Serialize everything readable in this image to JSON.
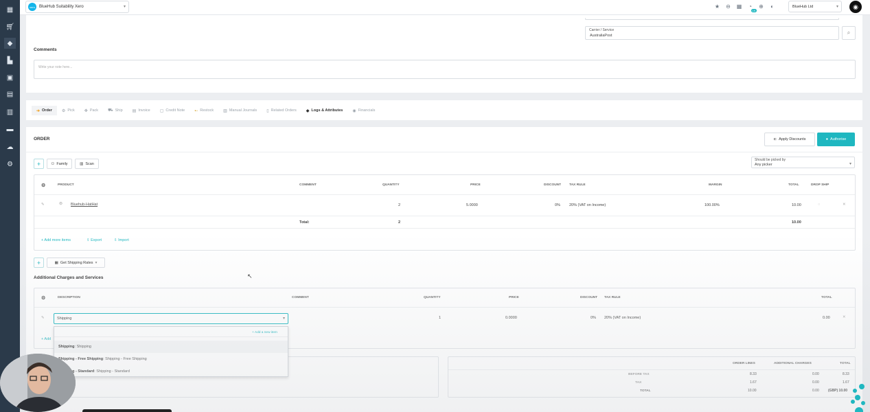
{
  "app": {
    "name": "BlueHub Suitability Xero",
    "logo_text": "xero",
    "company": "BlueHub Ltd"
  },
  "topbar": {
    "notif_badge": "19"
  },
  "carrier": {
    "label": "Carrier / Service",
    "value": "AustraliaPost"
  },
  "comments": {
    "title": "Comments",
    "placeholder": "Write your note here..."
  },
  "tabs": [
    "Order",
    "Pick",
    "Pack",
    "Ship",
    "Invoice",
    "Credit Note",
    "Restock",
    "Manual Journals",
    "Related Orders",
    "Logs & Attributes",
    "Financials"
  ],
  "order": {
    "title": "ORDER",
    "apply_discounts": "Apply Discounts",
    "authorise": "Authorise",
    "family": "Family",
    "scan": "Scan",
    "picker_label": "Should be picked by",
    "picker_value": "Any picker",
    "headers": [
      "PRODUCT",
      "COMMENT",
      "QUANTITY",
      "PRICE",
      "DISCOUNT",
      "TAX RULE",
      "MARGIN",
      "TOTAL",
      "DROP SHIP"
    ],
    "row": {
      "product": "Bluehub-HatHat",
      "quantity": "2",
      "price": "5.0000",
      "discount": "0%",
      "tax_rule": "20% (VAT on Income)",
      "margin": "100.00%",
      "total": "10.00"
    },
    "total_label": "Total:",
    "total_qty": "2",
    "total_amount": "10.00",
    "add_more": "+ Add more items",
    "export": "Export",
    "import": "Import"
  },
  "charges": {
    "get_rates": "Get Shipping Rates",
    "title": "Additional Charges and Services",
    "headers": [
      "DESCRIPTION",
      "COMMENT",
      "QUANTITY",
      "PRICE",
      "DISCOUNT",
      "TAX RULE",
      "TOTAL"
    ],
    "row": {
      "description": "Shipping",
      "quantity": "1",
      "price": "0.0000",
      "discount": "0%",
      "tax_rule": "20% (VAT on Income)",
      "total": "0.00"
    },
    "add_new_item": "+ Add a new item",
    "options": [
      {
        "bold": "Shipping",
        "rest": ": Shipping"
      },
      {
        "bold": "Shipping - Free Shipping",
        "rest": ": Shipping - Free Shipping"
      },
      {
        "bold": "Shipping - Standard",
        "rest": ": Shipping - Standard"
      }
    ],
    "add_partial": "+ Add"
  },
  "summary": {
    "headers": [
      "ORDER LINES",
      "ADDITIONAL CHARGES",
      "TOTAL"
    ],
    "rows": [
      {
        "label": "BEFORE TAX",
        "lines": "8.33",
        "charges": "0.00",
        "total": "8.33"
      },
      {
        "label": "TAX",
        "lines": "1.67",
        "charges": "0.00",
        "total": "1.67"
      },
      {
        "label": "TOTAL",
        "lines": "10.00",
        "charges": "0.00",
        "total": "(GBP) 10.00"
      }
    ]
  }
}
